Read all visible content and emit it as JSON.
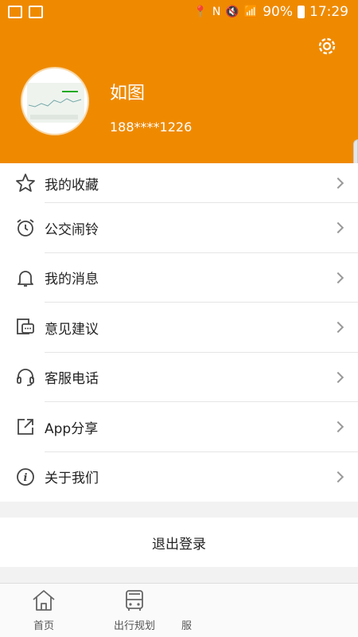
{
  "status_bar": {
    "battery": "90%",
    "time": "17:29"
  },
  "header": {
    "username": "如图",
    "phone": "188****1226"
  },
  "menu": [
    {
      "label": "我的收藏",
      "icon": "star-icon"
    },
    {
      "label": "公交闹铃",
      "icon": "alarm-clock-icon"
    },
    {
      "label": "我的消息",
      "icon": "bell-icon"
    },
    {
      "label": "意见建议",
      "icon": "feedback-icon"
    },
    {
      "label": "客服电话",
      "icon": "headset-icon"
    },
    {
      "label": "App分享",
      "icon": "share-icon"
    },
    {
      "label": "关于我们",
      "icon": "info-icon"
    }
  ],
  "logout_label": "退出登录",
  "tabs": [
    {
      "label": "首页",
      "icon": "home-icon"
    },
    {
      "label": "出行规划",
      "icon": "bus-icon"
    },
    {
      "label": "服",
      "icon": ""
    }
  ],
  "colors": {
    "header_bg": "#ef8a00",
    "text": "#222222"
  }
}
